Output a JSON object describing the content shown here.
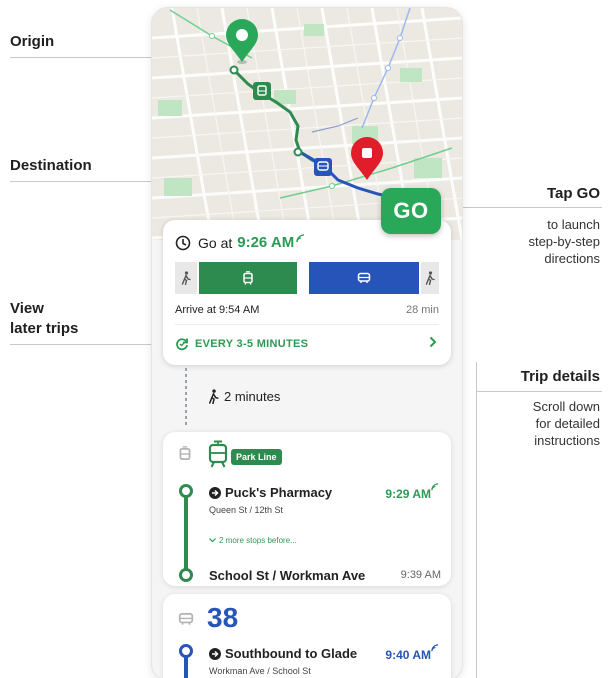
{
  "callouts": {
    "origin": "Origin",
    "destination": "Destination",
    "view_later_line1": "View",
    "view_later_line2": "later trips",
    "tap_go_title": "Tap GO",
    "tap_go_line1": "to launch",
    "tap_go_line2": "step-by-step",
    "tap_go_line3": "directions",
    "trip_details_title": "Trip details",
    "trip_details_line1": "Scroll down",
    "trip_details_line2": "for detailed",
    "trip_details_line3": "instructions"
  },
  "colors": {
    "green": "#2e8b4f",
    "go_green": "#2aa85a",
    "blue": "#2754b9",
    "red": "#e11d2b"
  },
  "go_button": {
    "label": "GO"
  },
  "summary": {
    "go_at_label": "Go at",
    "go_at_time": "9:26 AM",
    "arrive": "Arrive at 9:54 AM",
    "duration": "28 min",
    "frequency": "EVERY 3-5 MINUTES",
    "legs": [
      {
        "mode": "walk",
        "icon": "walk-icon",
        "share": 0.09
      },
      {
        "mode": "tram",
        "icon": "tram-icon",
        "share": 0.41
      },
      {
        "mode": "bus",
        "icon": "bus-icon",
        "share": 0.41
      },
      {
        "mode": "walk",
        "icon": "walk-icon",
        "share": 0.09
      }
    ]
  },
  "walk_segment": {
    "label": "2 minutes"
  },
  "tram_leg": {
    "route_name": "Park Line",
    "boarding_stop": "Puck's Pharmacy",
    "boarding_cross": "Queen St / 12th St",
    "boarding_time": "9:29 AM",
    "more_stops": "2 more stops before...",
    "alight_stop": "School St / Workman Ave",
    "alight_time": "9:39 AM"
  },
  "bus_leg": {
    "route_number": "38",
    "headsign": "Southbound to Glade",
    "boarding_cross": "Workman Ave / School St",
    "boarding_time": "9:40 AM"
  }
}
